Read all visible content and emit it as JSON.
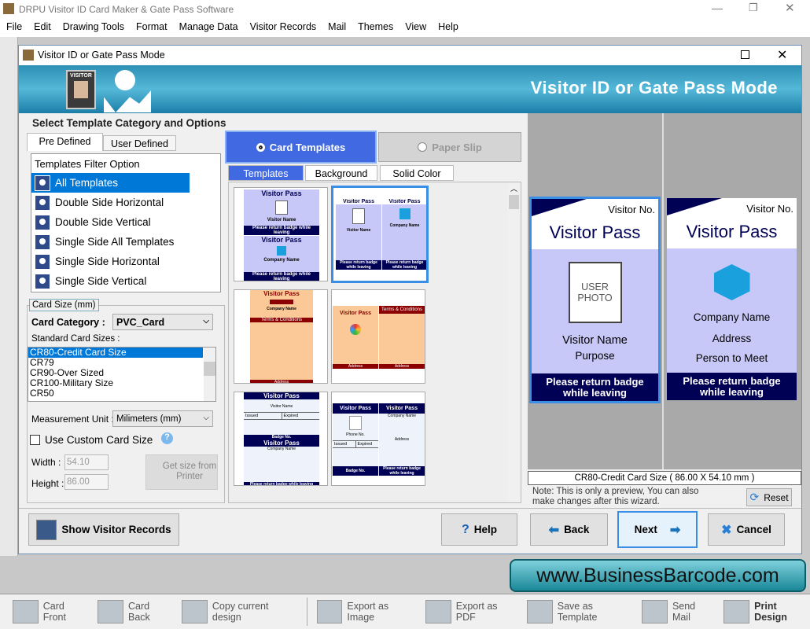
{
  "app": {
    "title": "DRPU Visitor ID Card Maker & Gate Pass Software",
    "menu": [
      "File",
      "Edit",
      "Drawing Tools",
      "Format",
      "Manage Data",
      "Visitor Records",
      "Mail",
      "Themes",
      "View",
      "Help"
    ]
  },
  "dialog": {
    "title": "Visitor ID or Gate Pass Mode",
    "banner_title": "Visitor ID or Gate Pass Mode",
    "badge_text": "VISITOR",
    "section_heading": "Select Template Category and Options",
    "tabs": [
      "Pre Defined",
      "User Defined"
    ],
    "filter": {
      "header": "Templates Filter Option",
      "items": [
        "All Templates",
        "Double Side Horizontal",
        "Double Side Vertical",
        "Single Side All Templates",
        "Single Side Horizontal",
        "Single Side Vertical"
      ],
      "selected": 0
    },
    "card_size": {
      "group_label": "Card Size (mm)",
      "category_label": "Card Category :",
      "category_value": "PVC_Card",
      "standard_label": "Standard Card Sizes :",
      "sizes": [
        "CR80-Credit Card Size",
        "CR79",
        "CR90-Over Sized",
        "CR100-Military Size",
        "CR50"
      ],
      "selected": 0,
      "unit_label": "Measurement Unit :",
      "unit_value": "Milimeters (mm)",
      "custom_label": "Use Custom Card Size",
      "custom_checked": false,
      "width_label": "Width :",
      "width_value": "54.10",
      "height_label": "Height :",
      "height_value": "86.00",
      "printer_button": "Get size from Printer"
    },
    "mode": {
      "card_templates": "Card Templates",
      "paper_slip": "Paper Slip",
      "selected": "card_templates"
    },
    "gallery_tabs": [
      "Templates",
      "Background",
      "Solid Color"
    ],
    "thumbs": {
      "visitor_pass": "Visitor Pass",
      "visitor_no": "Visitor No.",
      "visitor_name": "Visitor Name",
      "company_name": "Company Name",
      "terms": "Terms & Conditions",
      "address": "Address",
      "badge_no": "Badge No.",
      "phone": "Phone No.",
      "issued": "Issued",
      "expired": "Expired",
      "return": "Please return badge while leaving"
    },
    "preview": {
      "front": {
        "visitor_no": "Visitor No.",
        "title": "Visitor Pass",
        "photo": "USER PHOTO",
        "name": "Visitor Name",
        "purpose": "Purpose",
        "footer": "Please return badge while leaving"
      },
      "back": {
        "visitor_no": "Visitor No.",
        "title": "Visitor Pass",
        "company": "Company Name",
        "address": "Address",
        "person": "Person to Meet",
        "footer": "Please return badge while leaving"
      },
      "size_label": "CR80-Credit Card Size ( 86.00 X 54.10 mm )",
      "note": "Note: This is only a preview, You can also make changes after this wizard.",
      "reset": "Reset"
    },
    "buttons": {
      "records": "Show Visitor Records",
      "help": "Help",
      "back": "Back",
      "next": "Next",
      "cancel": "Cancel"
    }
  },
  "website": "www.BusinessBarcode.com",
  "toolbar": [
    "Card Front",
    "Card Back",
    "Copy current design",
    "Export as Image",
    "Export as PDF",
    "Save as Template",
    "Send Mail",
    "Print Design"
  ],
  "colors": {
    "accent": "#4169e1",
    "navy": "#000055",
    "selection": "#0078d7",
    "card_bg": "#c8c8f8"
  }
}
